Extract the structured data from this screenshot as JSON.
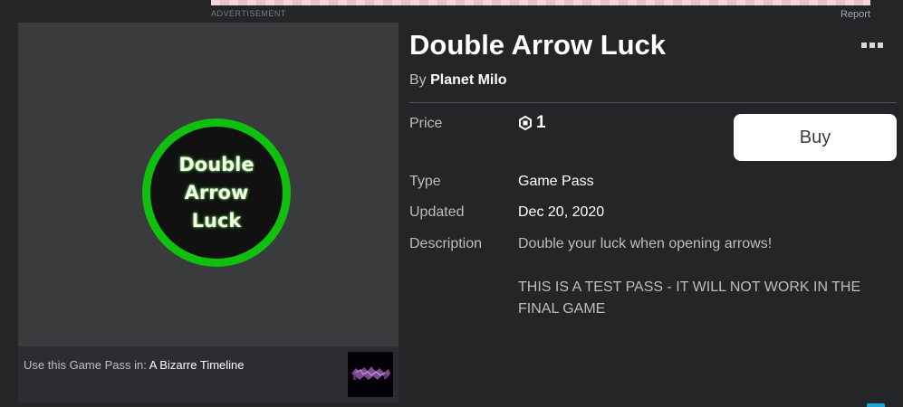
{
  "ad": {
    "label": "ADVERTISEMENT",
    "report": "Report"
  },
  "item": {
    "title": "Double Arrow Luck",
    "by_prefix": "By",
    "creator": "Planet Milo",
    "thumbnail_text": "Double Arrow Luck",
    "price_label": "Price",
    "price_value": "1",
    "buy_label": "Buy",
    "type_label": "Type",
    "type_value": "Game Pass",
    "updated_label": "Updated",
    "updated_value": "Dec 20, 2020",
    "description_label": "Description",
    "description": "Double your luck when opening arrows!\n\nTHIS IS A TEST PASS - IT WILL NOT WORK IN THE FINAL GAME"
  },
  "use_in": {
    "prefix": "Use this Game Pass in:",
    "game": "A Bizarre Timeline"
  },
  "colors": {
    "background": "#232527",
    "panel": "#393b3d",
    "badge_ring": "#10c00f",
    "buy_button": "#ffffff"
  },
  "icons": {
    "currency": "robux-icon",
    "menu": "more-options-icon"
  }
}
